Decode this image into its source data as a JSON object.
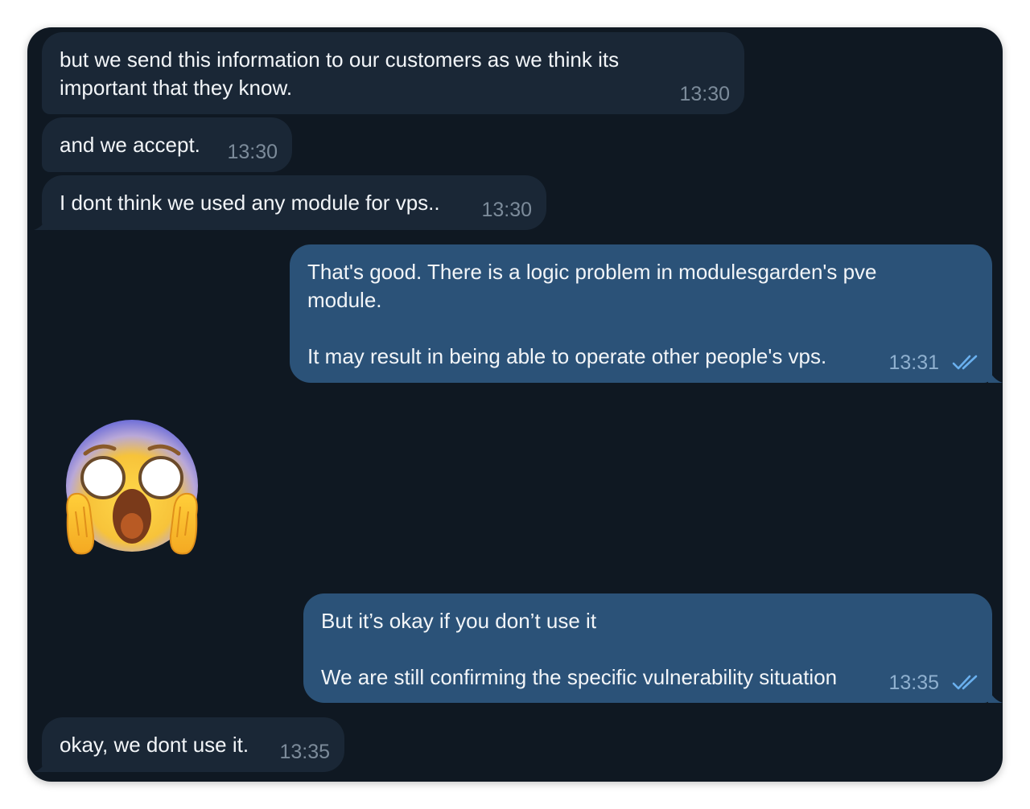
{
  "chat": {
    "messages": [
      {
        "direction": "incoming",
        "text": "but we send this information to our customers as we think its\nimportant that they know.",
        "time": "13:30"
      },
      {
        "direction": "incoming",
        "text": "and we accept.",
        "time": "13:30"
      },
      {
        "direction": "incoming",
        "text": "I dont think we used any module for vps..",
        "time": "13:30"
      },
      {
        "direction": "outgoing",
        "text": "That's good. There is a logic problem in modulesgarden's pve\nmodule.\n\nIt may result in being able to operate other people's vps.",
        "time": "13:31",
        "status": "double-check-read-icon"
      },
      {
        "direction": "incoming",
        "type": "emoji",
        "icon": "screaming-face-emoji"
      },
      {
        "direction": "outgoing",
        "text": "But it’s okay if you don’t use it\n\nWe are still confirming the specific vulnerability situation",
        "time": "13:35",
        "status": "double-check-read-icon"
      },
      {
        "direction": "incoming",
        "text": "okay, we dont use it.",
        "time": "13:35"
      }
    ]
  },
  "colors": {
    "background": "#0f1822",
    "incoming_bubble": "#1a2736",
    "outgoing_bubble": "#2b5278",
    "text": "#f2f5f8",
    "timestamp_incoming": "#7c8b9a",
    "check": "#6ab0ee"
  }
}
